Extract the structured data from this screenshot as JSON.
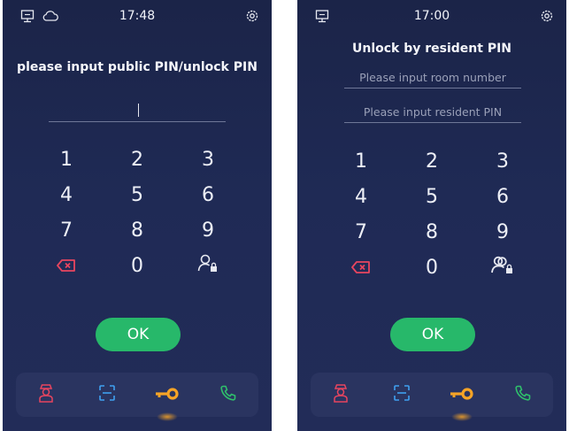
{
  "left": {
    "time": "17:48",
    "title": "please input public PIN/unlock PIN",
    "keys": [
      "1",
      "2",
      "3",
      "4",
      "5",
      "6",
      "7",
      "8",
      "9",
      "0"
    ],
    "ok_label": "OK"
  },
  "right": {
    "time": "17:00",
    "title": "Unlock by resident PIN",
    "room_placeholder": "Please input room number",
    "pin_placeholder": "Please input resident PIN",
    "keys": [
      "1",
      "2",
      "3",
      "4",
      "5",
      "6",
      "7",
      "8",
      "9",
      "0"
    ],
    "ok_label": "OK"
  },
  "colors": {
    "background": "#1f2a55",
    "ok_button": "#27b86a",
    "delete_icon": "#e8455f",
    "key_icon": "#f7a426",
    "call_icon": "#2fc06b",
    "scan_icon": "#3fa0f0",
    "visitor_icon": "#e8455f"
  },
  "icons": {
    "status": [
      "monitor-icon",
      "cloud-icon"
    ],
    "settings": "gear-icon",
    "keypad_left": "delete-icon",
    "keypad_right": "resident-lock-icon",
    "nav": [
      "visitor-icon",
      "scan-icon",
      "key-icon",
      "phone-icon"
    ]
  }
}
